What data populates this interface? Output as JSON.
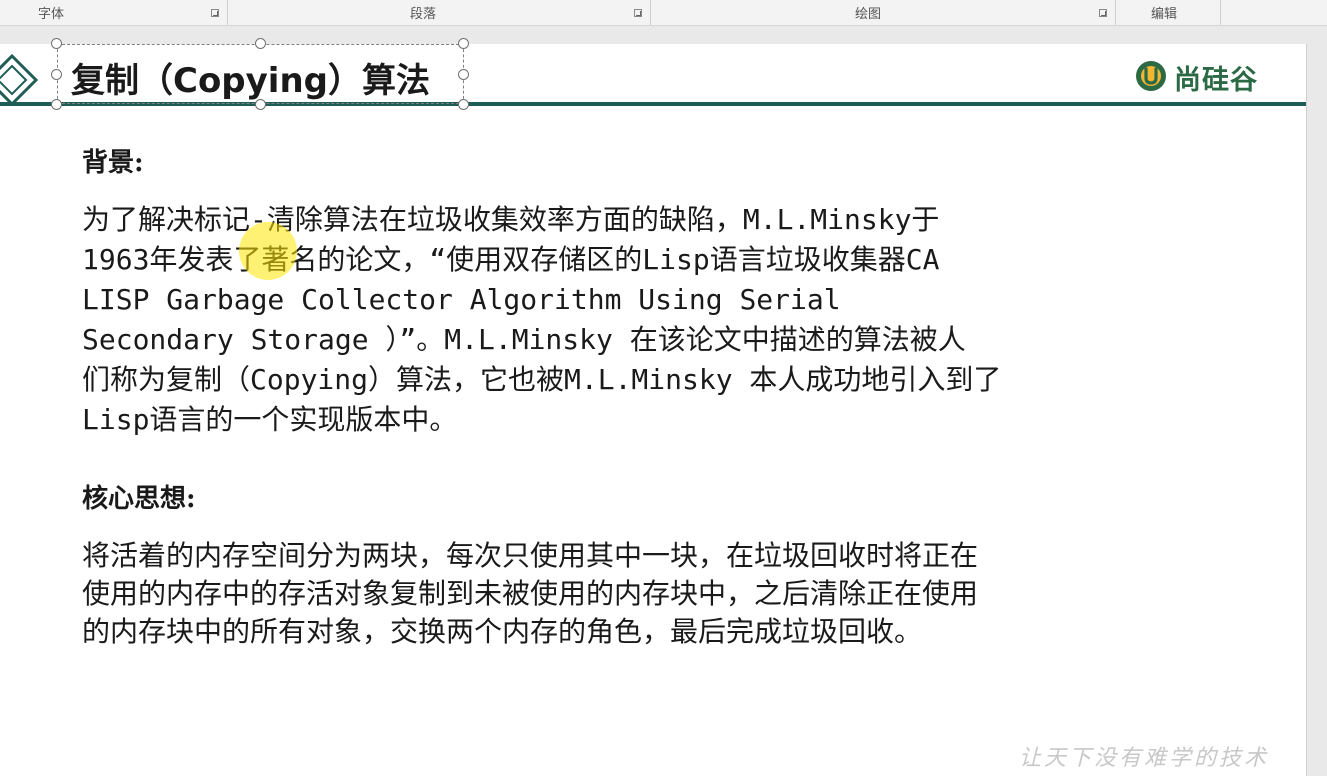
{
  "ribbon": {
    "groups": [
      {
        "label": "字体"
      },
      {
        "label": "段落"
      },
      {
        "label": "绘图"
      },
      {
        "label": "编辑"
      }
    ]
  },
  "slide": {
    "title": "复制（Copying）算法",
    "logo_text": "尚硅谷",
    "accent_color": "#1f5e57",
    "logo_color": "#2b6a45",
    "background_heading": "背景:",
    "background_lines": [
      "为了解决标记-清除算法在垃圾收集效率方面的缺陷，M.L.Minsky于",
      "1963年发表了著名的论文，“使用双存储区的Lisp语言垃圾收集器CA",
      "LISP Garbage Collector Algorithm Using Serial",
      "Secondary Storage ）”。M.L.Minsky 在该论文中描述的算法被人",
      "们称为复制（Copying）算法，它也被M.L.Minsky 本人成功地引入到了",
      "Lisp语言的一个实现版本中。"
    ],
    "core_heading": "核心思想:",
    "core_lines": [
      "将活着的内存空间分为两块，每次只使用其中一块，在垃圾回收时将正在",
      "使用的内存中的存活对象复制到未被使用的内存块中，之后清除正在使用",
      "的内存块中的所有对象，交换两个内存的角色，最后完成垃圾回收。"
    ]
  },
  "watermark": "让天下没有难学的技术",
  "icons": {
    "launcher": "dialog-launcher-icon",
    "diamond": "diamond-decoration-icon",
    "logo": "shangguigu-logo-icon"
  }
}
